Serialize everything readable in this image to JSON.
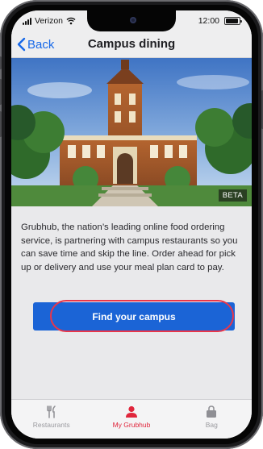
{
  "status_bar": {
    "carrier": "Verizon",
    "time": "12:00",
    "icons": [
      "signal-icon",
      "wifi-icon",
      "battery-icon"
    ]
  },
  "nav": {
    "back_label": "Back",
    "title": "Campus dining"
  },
  "hero": {
    "badge": "BETA"
  },
  "description": "Grubhub, the nation’s leading online food ordering service, is partnering with campus restaurants so you can save time and skip the line. Order ahead for pick up or delivery and use your meal plan card to pay.",
  "cta": {
    "label": "Find your campus"
  },
  "tabs": [
    {
      "label": "Restaurants",
      "icon": "fork-knife-icon",
      "active": false
    },
    {
      "label": "My Grubhub",
      "icon": "person-icon",
      "active": true
    },
    {
      "label": "Bag",
      "icon": "bag-icon",
      "active": false
    }
  ],
  "colors": {
    "accent": "#1b64d6",
    "active_tab": "#e0263c",
    "highlight_ring": "#e9364a"
  }
}
